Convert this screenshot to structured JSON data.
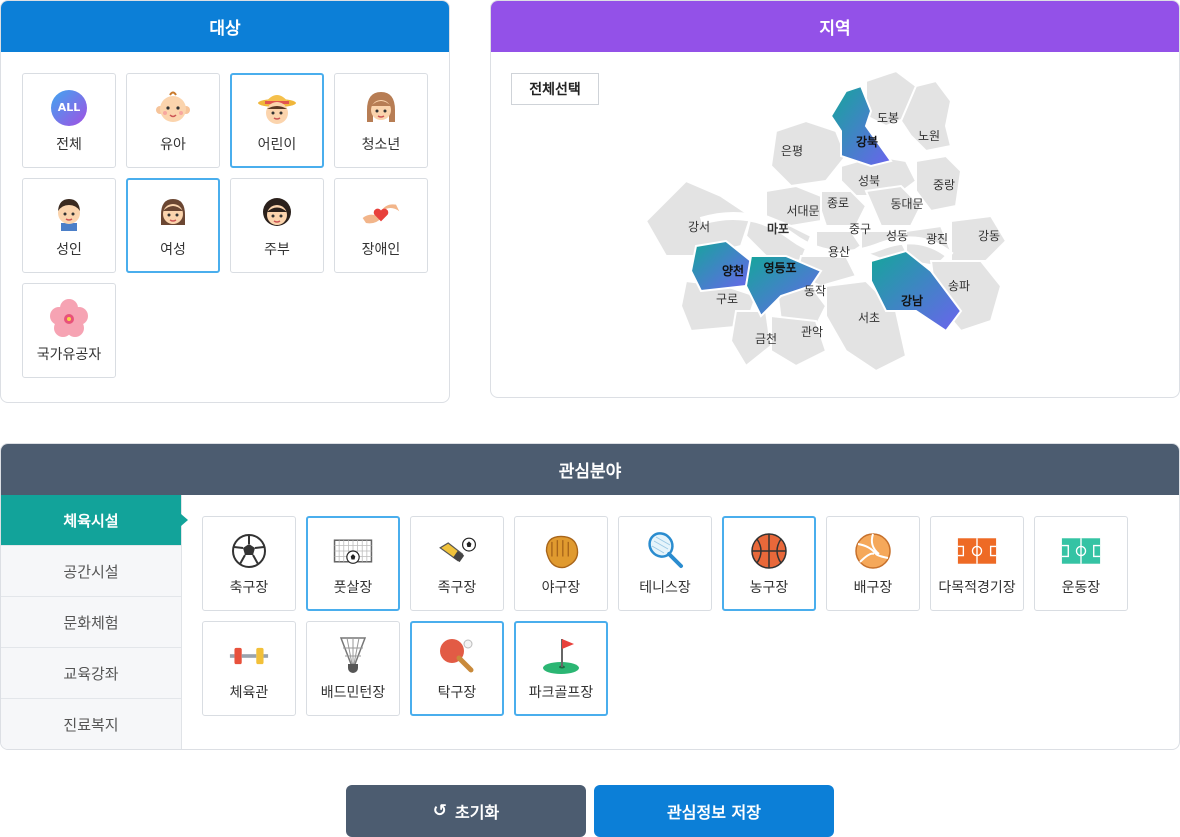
{
  "target": {
    "title": "대상",
    "items": [
      {
        "label": "전체",
        "icon": "all-badge-icon",
        "badge": "ALL"
      },
      {
        "label": "유아",
        "icon": "baby-face-icon"
      },
      {
        "label": "어린이",
        "icon": "child-face-icon"
      },
      {
        "label": "청소년",
        "icon": "teen-face-icon"
      },
      {
        "label": "성인",
        "icon": "adult-face-icon"
      },
      {
        "label": "여성",
        "icon": "woman-face-icon"
      },
      {
        "label": "주부",
        "icon": "housewife-face-icon"
      },
      {
        "label": "장애인",
        "icon": "hands-heart-icon"
      },
      {
        "label": "국가유공자",
        "icon": "hibiscus-flower-icon"
      }
    ],
    "selected": [
      "어린이",
      "여성"
    ]
  },
  "region": {
    "title": "지역",
    "select_all": "전체선택",
    "districts": [
      "도봉",
      "노원",
      "강북",
      "은평",
      "성북",
      "중랑",
      "서대문",
      "종로",
      "동대문",
      "강서",
      "마포",
      "중구",
      "성동",
      "광진",
      "강동",
      "용산",
      "양천",
      "영등포",
      "송파",
      "구로",
      "동작",
      "강남",
      "서초",
      "관악",
      "금천"
    ],
    "selected": [
      "강북",
      "양천",
      "영등포",
      "강남"
    ]
  },
  "interest": {
    "title": "관심분야",
    "tabs": [
      "체육시설",
      "공간시설",
      "문화체험",
      "교육강좌",
      "진료복지"
    ],
    "active_tab": "체육시설",
    "items": [
      {
        "label": "축구장",
        "icon": "soccer-ball-icon"
      },
      {
        "label": "풋살장",
        "icon": "futsal-goal-icon"
      },
      {
        "label": "족구장",
        "icon": "kick-shoe-ball-icon"
      },
      {
        "label": "야구장",
        "icon": "baseball-glove-icon"
      },
      {
        "label": "테니스장",
        "icon": "tennis-racket-icon"
      },
      {
        "label": "농구장",
        "icon": "basketball-icon"
      },
      {
        "label": "배구장",
        "icon": "volleyball-icon"
      },
      {
        "label": "다목적경기장",
        "icon": "multipurpose-court-icon"
      },
      {
        "label": "운동장",
        "icon": "field-icon"
      },
      {
        "label": "체육관",
        "icon": "dumbbell-icon"
      },
      {
        "label": "배드민턴장",
        "icon": "shuttlecock-icon"
      },
      {
        "label": "탁구장",
        "icon": "ping-pong-paddle-icon"
      },
      {
        "label": "파크골프장",
        "icon": "golf-flag-icon"
      }
    ],
    "selected": [
      "풋살장",
      "농구장",
      "탁구장",
      "파크골프장"
    ]
  },
  "buttons": {
    "reset": "초기화",
    "save": "관심정보 저장"
  },
  "colors": {
    "target_header": "#0c7fd7",
    "region_header": "#9351e8",
    "interest_header": "#4c5c70",
    "selected_border": "#4aaeed",
    "active_tab": "#12a39a",
    "map_selected_start": "#14a69a",
    "map_selected_end": "#6b63ee",
    "map_default": "#e3e3e3"
  }
}
